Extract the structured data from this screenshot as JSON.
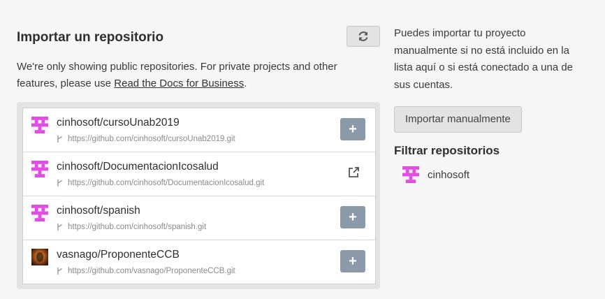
{
  "main": {
    "title": "Importar un repositorio",
    "refresh_icon": "refresh-icon",
    "intro_text": "We're only showing public repositories. For private projects and other features, please use ",
    "intro_link": "Read the Docs for Business",
    "intro_end": "."
  },
  "repos": [
    {
      "name": "cinhosoft/cursoUnab2019",
      "url": "https://github.com/cinhosoft/cursoUnab2019.git",
      "action": "add",
      "action_label": "+"
    },
    {
      "name": "cinhosoft/DocumentacionIcosalud",
      "url": "https://github.com/cinhosoft/DocumentacionIcosalud.git",
      "action": "external-link"
    },
    {
      "name": "cinhosoft/spanish",
      "url": "https://github.com/cinhosoft/spanish.git",
      "action": "add",
      "action_label": "+"
    },
    {
      "name": "vasnago/ProponenteCCB",
      "url": "https://github.com/vasnago/ProponenteCCB.git",
      "action": "add",
      "action_label": "+"
    }
  ],
  "side": {
    "text": "Puedes importar tu proyecto manualmente si no está incluido en la lista aquí o si está conectado a una de sus cuentas.",
    "manual_button": "Importar manualmente",
    "filter_title": "Filtrar repositorios",
    "filter_items": [
      {
        "label": "cinhosoft"
      }
    ]
  },
  "colors": {
    "identicon": "#e04de0",
    "add_button": "#8a9aa8",
    "background": "#f6f6f6"
  }
}
